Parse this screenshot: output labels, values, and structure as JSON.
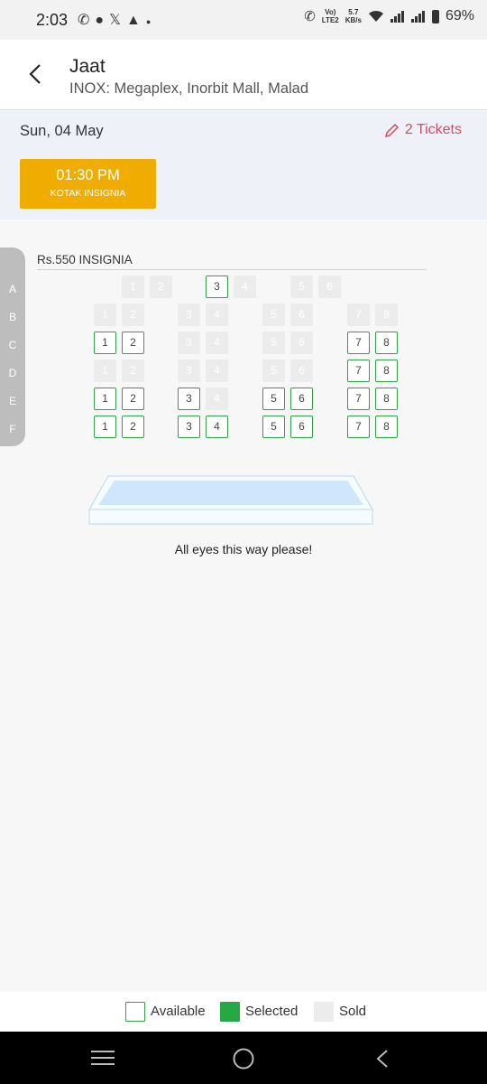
{
  "status": {
    "time": "2:03",
    "volte_top": "Vo)",
    "volte_bottom": "LTE2",
    "net_speed_top": "5.7",
    "net_speed_bottom": "KB/s",
    "battery": "69%"
  },
  "header": {
    "title": "Jaat",
    "venue": "INOX: Megaplex, Inorbit Mall, Malad"
  },
  "show": {
    "date": "Sun, 04 May",
    "tickets_label": "2 Tickets",
    "time": "01:30 PM",
    "format": "KOTAK INSIGNIA"
  },
  "seating": {
    "price_label": "Rs.550  INSIGNIA",
    "rows": [
      "A",
      "B",
      "C",
      "D",
      "E",
      "F"
    ],
    "seats": {
      "A": [
        {
          "n": "1",
          "status": "sold"
        },
        {
          "n": "2",
          "status": "sold"
        },
        {
          "n": "3",
          "status": "available"
        },
        {
          "n": "4",
          "status": "sold"
        },
        {
          "n": "5",
          "status": "sold"
        },
        {
          "n": "6",
          "status": "sold"
        }
      ],
      "B": [
        {
          "n": "1",
          "status": "sold"
        },
        {
          "n": "2",
          "status": "sold"
        },
        {
          "n": "3",
          "status": "sold"
        },
        {
          "n": "4",
          "status": "sold"
        },
        {
          "n": "5",
          "status": "sold"
        },
        {
          "n": "6",
          "status": "sold"
        },
        {
          "n": "7",
          "status": "sold"
        },
        {
          "n": "8",
          "status": "sold"
        }
      ],
      "C": [
        {
          "n": "1",
          "status": "available"
        },
        {
          "n": "2",
          "status": "available"
        },
        {
          "n": "3",
          "status": "sold"
        },
        {
          "n": "4",
          "status": "sold"
        },
        {
          "n": "5",
          "status": "sold"
        },
        {
          "n": "6",
          "status": "sold"
        },
        {
          "n": "7",
          "status": "available"
        },
        {
          "n": "8",
          "status": "available"
        }
      ],
      "D": [
        {
          "n": "1",
          "status": "sold"
        },
        {
          "n": "2",
          "status": "sold"
        },
        {
          "n": "3",
          "status": "sold"
        },
        {
          "n": "4",
          "status": "sold"
        },
        {
          "n": "5",
          "status": "sold"
        },
        {
          "n": "6",
          "status": "sold"
        },
        {
          "n": "7",
          "status": "available"
        },
        {
          "n": "8",
          "status": "available"
        }
      ],
      "E": [
        {
          "n": "1",
          "status": "available"
        },
        {
          "n": "2",
          "status": "available"
        },
        {
          "n": "3",
          "status": "available"
        },
        {
          "n": "4",
          "status": "sold"
        },
        {
          "n": "5",
          "status": "available"
        },
        {
          "n": "6",
          "status": "available"
        },
        {
          "n": "7",
          "status": "available"
        },
        {
          "n": "8",
          "status": "available"
        }
      ],
      "F": [
        {
          "n": "1",
          "status": "available"
        },
        {
          "n": "2",
          "status": "available"
        },
        {
          "n": "3",
          "status": "available"
        },
        {
          "n": "4",
          "status": "available"
        },
        {
          "n": "5",
          "status": "available"
        },
        {
          "n": "6",
          "status": "available"
        },
        {
          "n": "7",
          "status": "available"
        },
        {
          "n": "8",
          "status": "available"
        }
      ]
    },
    "screen_text": "All eyes this way please!"
  },
  "legend": {
    "available": "Available",
    "selected": "Selected",
    "sold": "Sold"
  },
  "colors": {
    "accent": "#f0ad00",
    "available_border": "#2da544",
    "selected": "#27a844",
    "sold": "#ececec",
    "tickets": "#d94b5c"
  },
  "icons": {
    "back": "chevron-left-icon",
    "edit": "pencil-icon",
    "nav_menu": "menu-icon",
    "nav_home": "home-circle-icon",
    "nav_back": "back-chevron-icon"
  }
}
